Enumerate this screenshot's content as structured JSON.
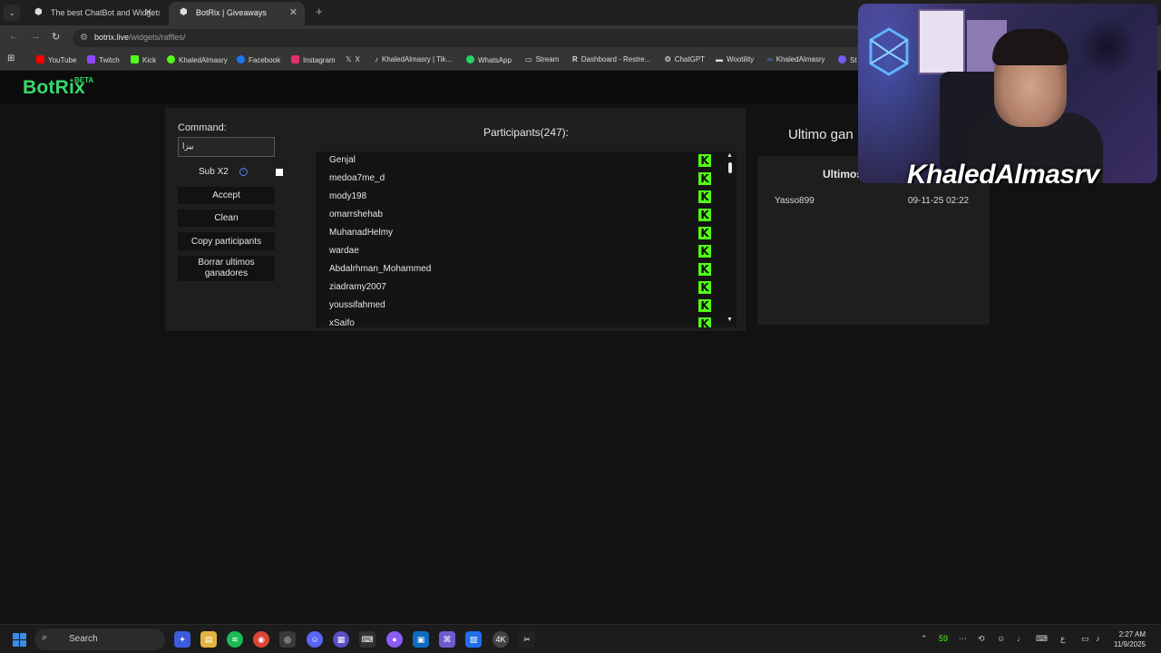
{
  "browser": {
    "tabs": [
      {
        "title": "The best ChatBot and Widgets",
        "active": false
      },
      {
        "title": "BotRix | Giveaways",
        "active": true
      }
    ],
    "url_host": "botrix.live",
    "url_path": "/widgets/raffles/",
    "bookmarks": [
      {
        "label": "YouTube",
        "color": "#ff0000"
      },
      {
        "label": "Twitch",
        "color": "#9146ff"
      },
      {
        "label": "Kick",
        "color": "#53fc18"
      },
      {
        "label": "KhaledAlmasry",
        "color": "#53fc18"
      },
      {
        "label": "Facebook",
        "color": "#1877f2"
      },
      {
        "label": "Instagram",
        "color": "#e1306c"
      },
      {
        "label": "X",
        "color": "#ffffff"
      },
      {
        "label": "KhaledAlmasry | Tik...",
        "color": "#111111"
      },
      {
        "label": "WhatsApp",
        "color": "#25d366"
      },
      {
        "label": "Stream",
        "color": "#888888"
      },
      {
        "label": "Dashboard - Restre...",
        "color": "#111111"
      },
      {
        "label": "ChatGPT",
        "color": "#dddddd"
      },
      {
        "label": "Wootility",
        "color": "#bbbbbb"
      },
      {
        "label": "KhaledAlmasry",
        "color": "#4f86ff"
      },
      {
        "label": "St",
        "color": "#7a5af8"
      }
    ]
  },
  "header": {
    "logo": "BotRix",
    "beta": "BETA"
  },
  "raffle": {
    "command_label": "Command:",
    "command_value": "بيزا",
    "sub_label": "Sub X2",
    "accept": "Accept",
    "clean": "Clean",
    "copy": "Copy participants",
    "clear_winners": "Borrar ultimos ganadores",
    "participants_title": "Participants(247):",
    "participants": [
      "Genjal",
      "medoa7me_d",
      "mody198",
      "omarrshehab",
      "MuhanadHelmy",
      "wardae",
      "Abdalrhman_Mohammed",
      "ziadramy2007",
      "youssifahmed",
      "xSaifo"
    ],
    "kick_badge": "K"
  },
  "winners": {
    "title": "Ultimo gan",
    "head": "Ultimos",
    "rows": [
      {
        "name": "Yasso899",
        "date": "09-11-25 02:22"
      }
    ]
  },
  "webcam": {
    "name": "KhaledAlmasry"
  },
  "taskbar": {
    "search": "Search",
    "tray_temp": "59",
    "time": "2:27 AM",
    "date": "11/9/2025"
  },
  "colors": {
    "accent_green": "#3ad86b",
    "kick_green": "#53fc18"
  }
}
